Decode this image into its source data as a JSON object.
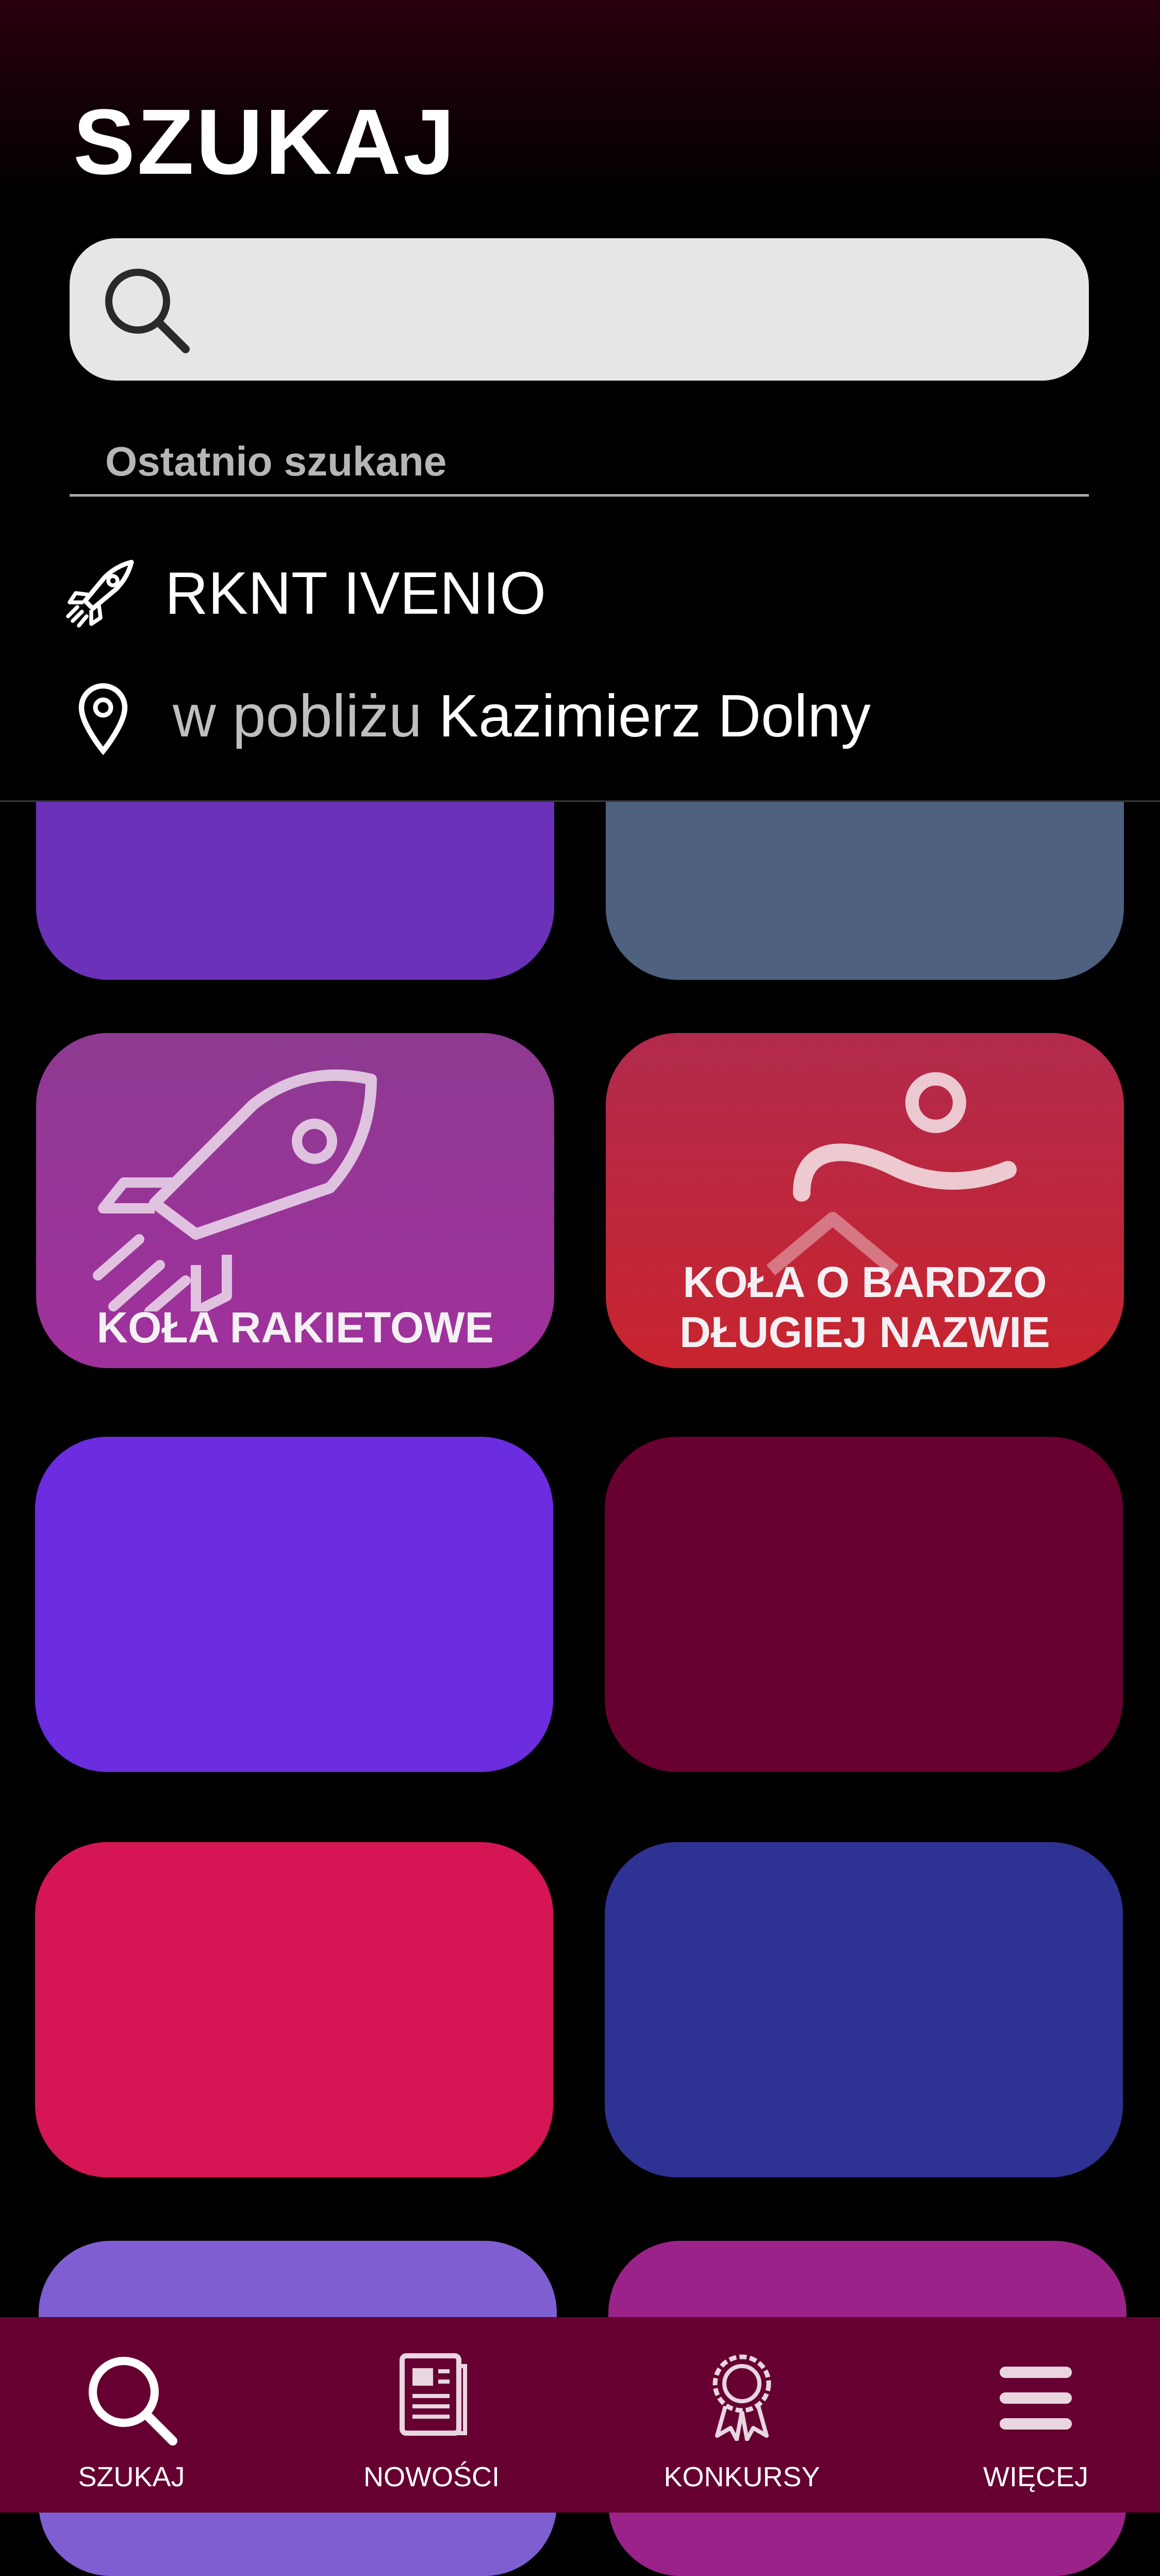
{
  "header": {
    "title": "SZUKAJ",
    "search_placeholder": "",
    "recent_label": "Ostatnio szukane"
  },
  "recent": [
    {
      "icon": "rocket-icon",
      "text": "RKNT IVENIO"
    },
    {
      "icon": "location-pin-icon",
      "prefix": "w pobliżu",
      "text": "Kazimierz Dolny"
    }
  ],
  "tiles": [
    {
      "color": "#6b31b8",
      "label": ""
    },
    {
      "color": "#4e6280",
      "label": ""
    },
    {
      "color": "#9a2e98",
      "label": "KOŁA RAKIETOWE",
      "icon": "rocket-icon"
    },
    {
      "color": "#c0273e",
      "label": "KOŁA O BARDZO\nDŁUGIEJ NAZWIE",
      "icon": "runner-icon"
    },
    {
      "color": "#6c2cdf",
      "label": ""
    },
    {
      "color": "#680030",
      "label": ""
    },
    {
      "color": "#d61554",
      "label": ""
    },
    {
      "color": "#2e3292",
      "label": ""
    },
    {
      "color": "#7e5ed0",
      "label": ""
    },
    {
      "color": "#9a2288",
      "label": ""
    }
  ],
  "nav": [
    {
      "label": "SZUKAJ",
      "icon": "search-icon"
    },
    {
      "label": "NOWOŚCI",
      "icon": "newspaper-icon"
    },
    {
      "label": "KONKURSY",
      "icon": "award-icon"
    },
    {
      "label": "WIĘCEJ",
      "icon": "menu-icon"
    }
  ],
  "colors": {
    "nav_bg": "#660030",
    "header_top": "#2a0010",
    "search_bg": "#e6e6e6"
  }
}
